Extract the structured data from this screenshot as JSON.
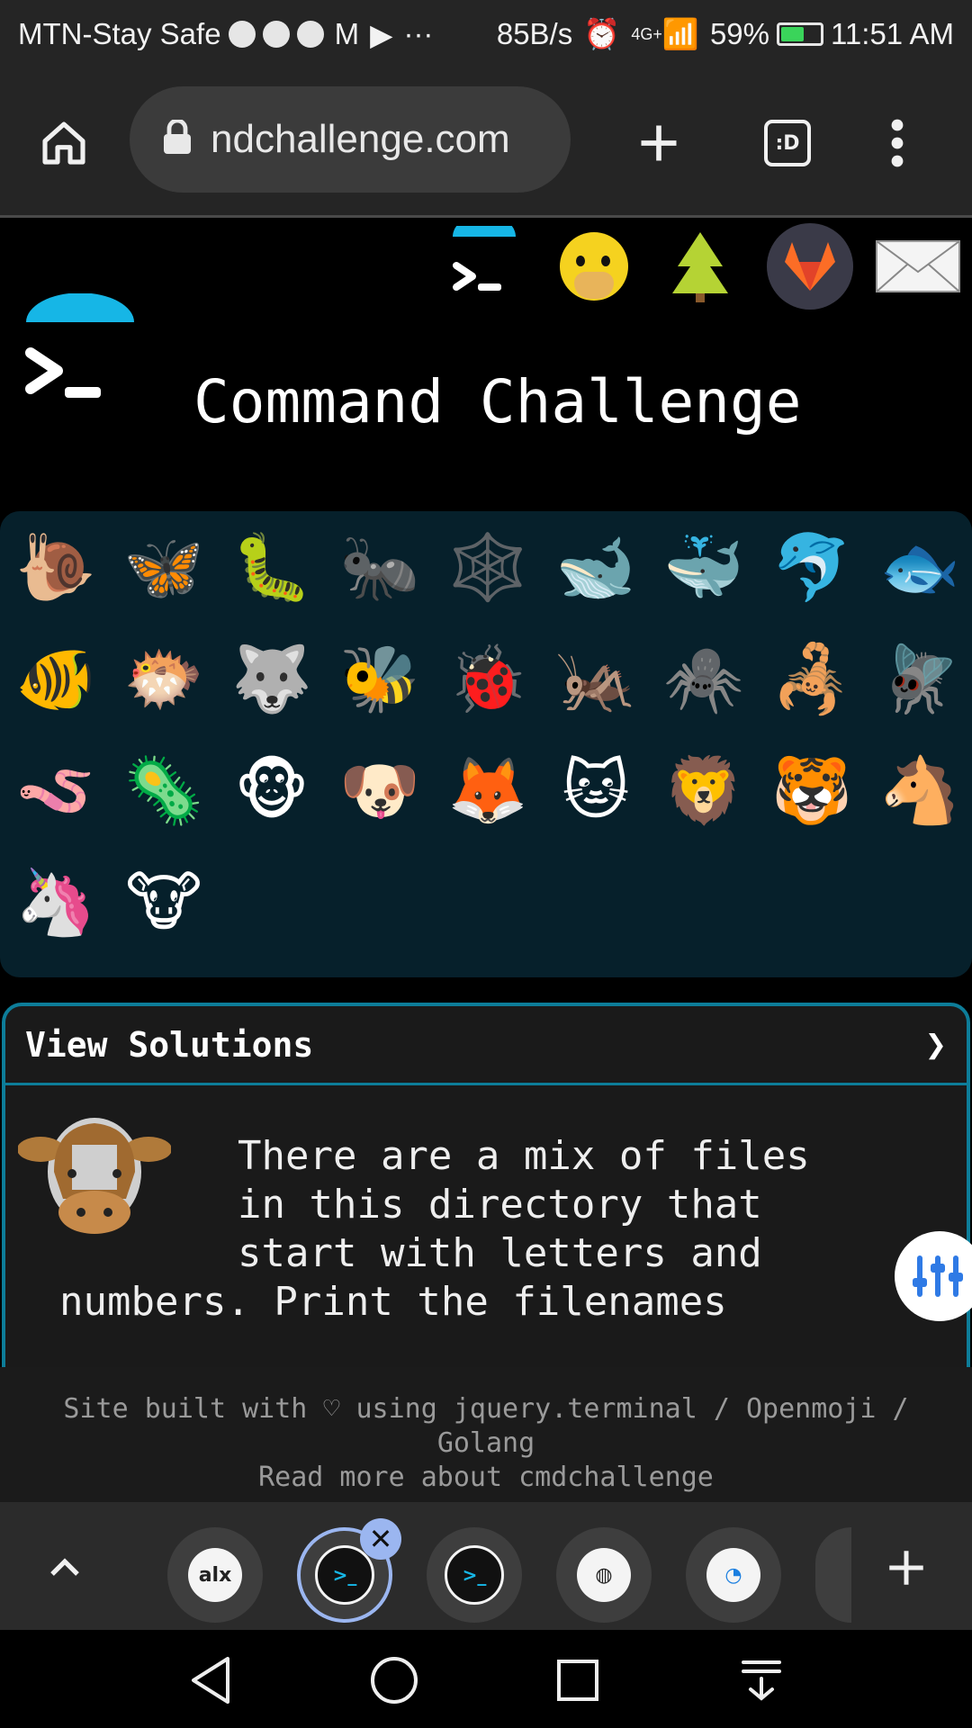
{
  "status_bar": {
    "carrier": "MTN-Stay Safe",
    "speed": "85B/s",
    "network": "4G+",
    "battery": "59%",
    "time": "11:51 AM",
    "battery_level": 0.59
  },
  "browser": {
    "url": "ndchallenge.com",
    "tab_count_icon": ":D",
    "icons": [
      "home-icon",
      "lock-icon",
      "new-tab-icon",
      "tab-switcher-icon",
      "more-vert-icon"
    ]
  },
  "page": {
    "title": "Command Challenge",
    "top_icons": [
      "terminal-logo-icon",
      "face-hand-over-mouth-icon",
      "tree-icon",
      "gitlab-icon",
      "mail-icon"
    ],
    "animals": [
      "🐌",
      "🦋",
      "🐛",
      "🐜",
      "🕸️",
      "🐋",
      "🐳",
      "🐬",
      "🐟",
      "🐠",
      "🐡",
      "🐺",
      "🐝",
      "🐞",
      "🦗",
      "🕷️",
      "🦂",
      "🪰",
      "🪱",
      "🦠",
      "🐵",
      "🐶",
      "🦊",
      "🐱",
      "🦁",
      "🐯",
      "🐴",
      "🦄",
      "🐮"
    ],
    "solutions": {
      "header": "View Solutions",
      "chevron": "❯",
      "text_line1": "There are a mix of files",
      "text_line2": "in this directory that",
      "text_line3": "start with letters and",
      "text_line4": "numbers. Print the filenames"
    },
    "footer": {
      "line1": "Site built with ♡ using jquery.terminal / Openmoji /",
      "line2": "Golang",
      "line3": "Read more about cmdchallenge"
    }
  },
  "tabs": {
    "items": [
      "alx",
      "cmdchallenge",
      "cmdchallenge",
      "globe",
      "digitalocean",
      "partial"
    ],
    "active_index": 1
  },
  "navbar": {
    "icons": [
      "back-icon",
      "home-circle-icon",
      "recents-icon",
      "notification-down-icon"
    ]
  }
}
